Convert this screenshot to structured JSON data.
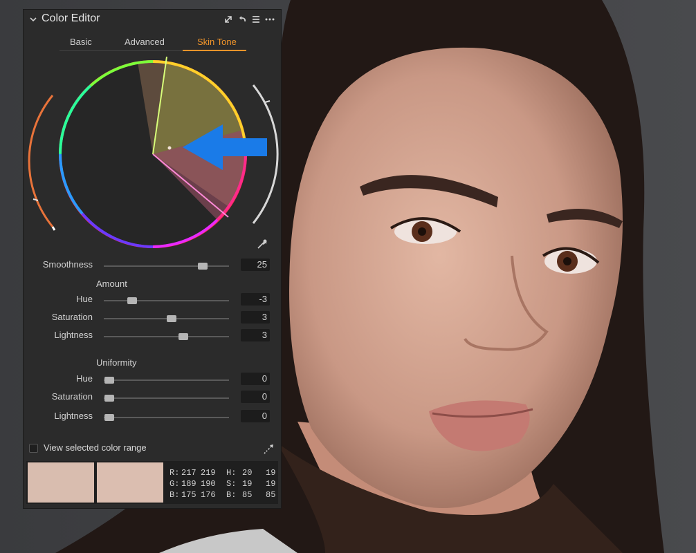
{
  "panel": {
    "title": "Color Editor",
    "icons": [
      "chevron-down-icon",
      "expand-icon",
      "reset-icon",
      "list-icon",
      "more-icon"
    ]
  },
  "tabs": [
    {
      "label": "Basic",
      "active": false
    },
    {
      "label": "Advanced",
      "active": false
    },
    {
      "label": "Skin Tone",
      "active": true
    }
  ],
  "accent_color": "#f0942a",
  "annotation_arrow_color": "#1a7be8",
  "smoothness": {
    "label": "Smoothness",
    "value": "25",
    "position": 0.78
  },
  "amount": {
    "title": "Amount",
    "sliders": [
      {
        "label": "Hue",
        "value": "-3",
        "position": 0.23
      },
      {
        "label": "Saturation",
        "value": "3",
        "position": 0.55
      },
      {
        "label": "Lightness",
        "value": "3",
        "position": 0.64
      }
    ]
  },
  "uniformity": {
    "title": "Uniformity",
    "sliders": [
      {
        "label": "Hue",
        "value": "0",
        "position": 0.05
      },
      {
        "label": "Saturation",
        "value": "0",
        "position": 0.05
      },
      {
        "label": "Lightness",
        "value": "0",
        "position": 0.05
      }
    ]
  },
  "view_range_label": "View selected color range",
  "swatches": [
    "#d9bdaf",
    "#dbbeb0"
  ],
  "readout": {
    "rgb": [
      {
        "ch": "R:",
        "a": "217",
        "b": "219"
      },
      {
        "ch": "G:",
        "a": "189",
        "b": "190"
      },
      {
        "ch": "B:",
        "a": "175",
        "b": "176"
      }
    ],
    "hsb": [
      {
        "ch": "H:",
        "a": "20",
        "b": "19"
      },
      {
        "ch": "S:",
        "a": "19",
        "b": "19"
      },
      {
        "ch": "B:",
        "a": "85",
        "b": "85"
      }
    ]
  }
}
